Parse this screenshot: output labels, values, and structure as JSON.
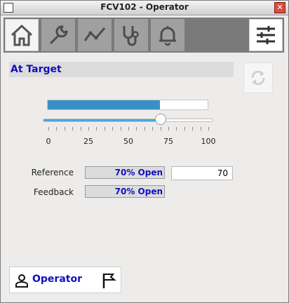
{
  "window": {
    "title": "FCV102 - Operator",
    "close_glyph": "✕"
  },
  "toolbar": {
    "tools": [
      {
        "icon": "home-icon",
        "active": true
      },
      {
        "icon": "wrench-icon"
      },
      {
        "icon": "trend-icon"
      },
      {
        "icon": "stethoscope-icon"
      },
      {
        "icon": "bell-icon"
      }
    ],
    "right_tool": {
      "icon": "sliders-icon"
    }
  },
  "status": {
    "text": "At Target"
  },
  "refresh": {
    "icon": "refresh-icon"
  },
  "output_bar": {
    "percent": 70
  },
  "slider": {
    "value": 70,
    "min": 0,
    "max": 100,
    "tick_labels": [
      "0",
      "25",
      "50",
      "75",
      "100"
    ]
  },
  "reference": {
    "label": "Reference",
    "display": "70% Open",
    "input_value": "70"
  },
  "feedback": {
    "label": "Feedback",
    "display": "70% Open"
  },
  "user": {
    "name": "Operator",
    "person_icon": "person-icon",
    "flag_icon": "flag-icon"
  },
  "colors": {
    "accent": "#3b8fc4",
    "slider": "#4aa6dd",
    "text_blue": "#1010c0"
  }
}
